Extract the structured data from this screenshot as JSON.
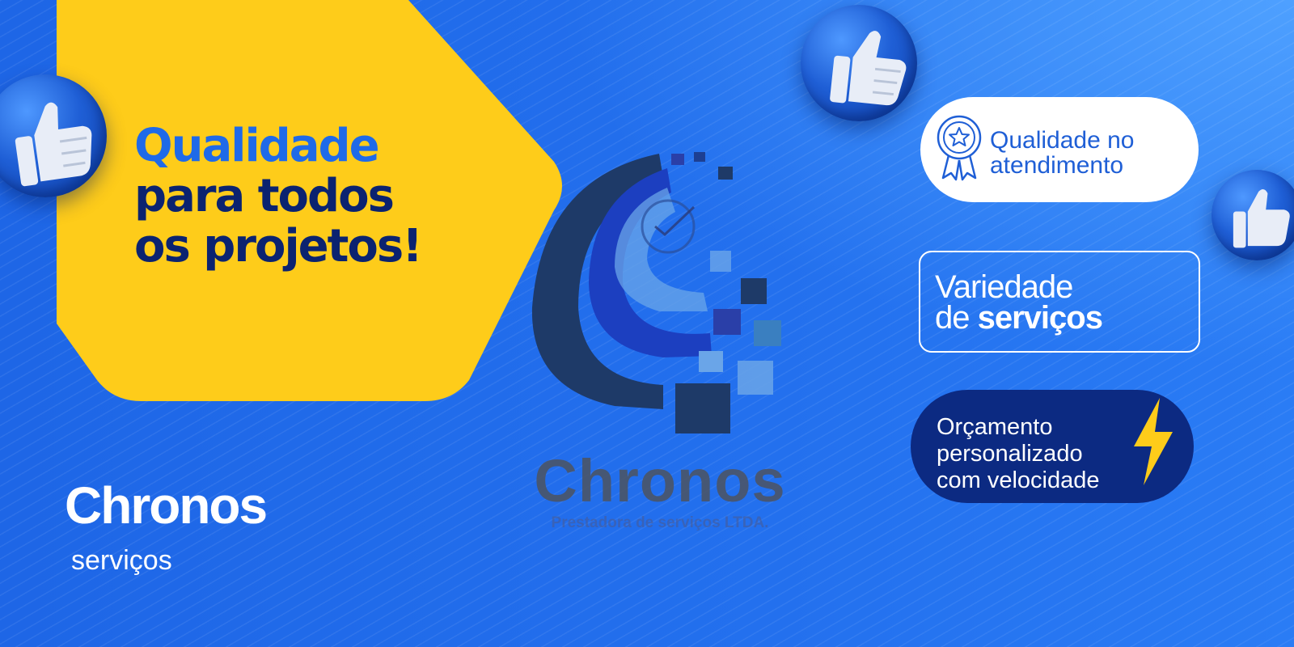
{
  "headline": {
    "line1": "Qualidade",
    "line2": "para todos",
    "line3": "os projetos!"
  },
  "brand": {
    "name": "Chronos",
    "subtitle": "serviços"
  },
  "logo": {
    "word": "Chronos",
    "tagline": "Prestadora de serviços LTDA."
  },
  "features": {
    "quality": {
      "line1": "Qualidade no",
      "line2": "atendimento",
      "icon": "award-ribbon-icon"
    },
    "variety": {
      "line1": "Variedade",
      "line2_light": "de ",
      "line2_bold": "serviços"
    },
    "budget": {
      "line1": "Orçamento",
      "line2": "personalizado",
      "line3": "com velocidade",
      "icon": "lightning-bolt-icon"
    }
  },
  "colors": {
    "background": "#1f6ae8",
    "yellow": "#fecc1a",
    "navy": "#0b2370",
    "white": "#ffffff"
  }
}
